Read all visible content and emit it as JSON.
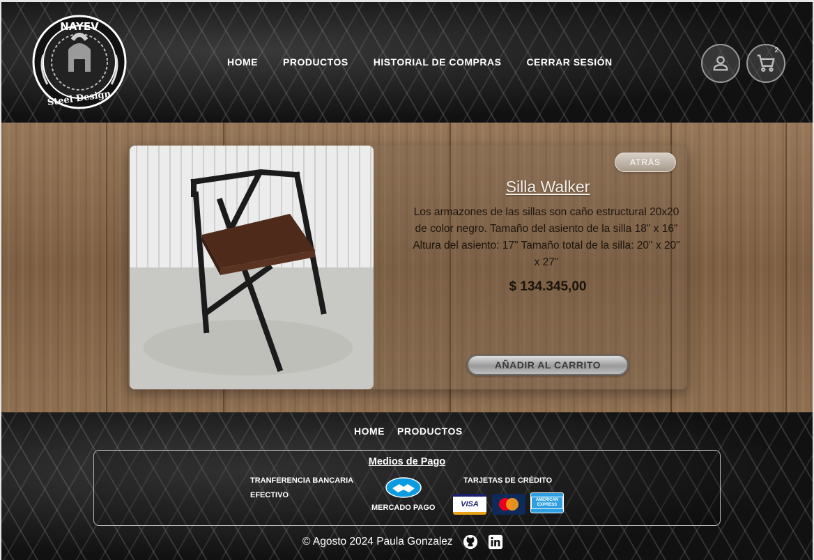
{
  "brand": {
    "top_text": "NAYEV",
    "bottom_text": "Steel Design"
  },
  "header": {
    "nav": [
      {
        "label": "HOME"
      },
      {
        "label": "PRODUCTOS"
      },
      {
        "label": "HISTORIAL DE COMPRAS"
      },
      {
        "label": "CERRAR SESIÓN"
      }
    ],
    "user_icon": "user-icon",
    "cart_icon": "cart-icon",
    "cart_count": "2"
  },
  "product": {
    "back_label": "ATRÁS",
    "title": "Silla Walker",
    "description": "Los armazones de las sillas son caño estructural 20x20 de color negro. Tamaño del asiento de la silla 18\" x 16\" Altura del asiento: 17\" Tamaño total de la silla: 20\" x 20\" x 27\"",
    "price": "$ 134.345,00",
    "add_to_cart_label": "AÑADIR AL CARRITO"
  },
  "footer": {
    "nav": [
      {
        "label": "HOME"
      },
      {
        "label": "PRODUCTOS"
      }
    ],
    "payments": {
      "title": "Medios de Pago",
      "transfer": "TRANFERENCIA BANCARIA",
      "cash": "EFECTIVO",
      "mercado_pago": "MERCADO PAGO",
      "credit_cards": "TARJETAS DE CRÉDITO",
      "visa": "VISA",
      "amex": "AMERICAN EXPRESS"
    },
    "copyright": "© Agosto 2024 Paula Gonzalez",
    "social": [
      "github-icon",
      "linkedin-icon"
    ]
  },
  "colors": {
    "accent_text": "#ffffff",
    "wood": "#8a6a4c",
    "metal": "#141414"
  }
}
